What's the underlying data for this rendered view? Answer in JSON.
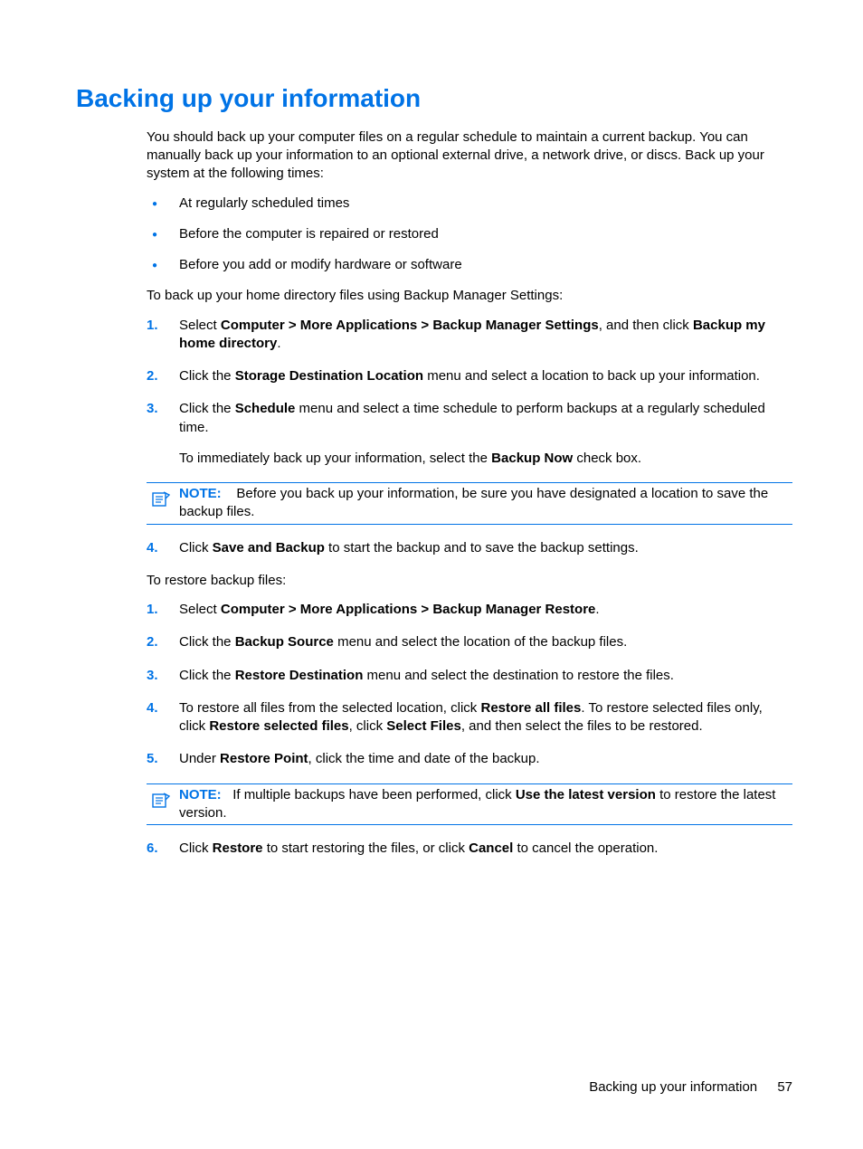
{
  "title": "Backing up your information",
  "intro": "You should back up your computer files on a regular schedule to maintain a current backup. You can manually back up your information to an optional external drive, a network drive, or discs. Back up your system at the following times:",
  "bullets": [
    "At regularly scheduled times",
    "Before the computer is repaired or restored",
    "Before you add or modify hardware or software"
  ],
  "backup_lead": "To back up your home directory files using Backup Manager Settings:",
  "backup_steps": {
    "s1_a": "Select ",
    "s1_b": "Computer > More Applications > Backup Manager Settings",
    "s1_c": ", and then click ",
    "s1_d": "Backup my home directory",
    "s1_e": ".",
    "s2_a": "Click the ",
    "s2_b": "Storage Destination Location",
    "s2_c": " menu and select a location to back up your information.",
    "s3_a": "Click the ",
    "s3_b": "Schedule",
    "s3_c": " menu and select a time schedule to perform backups at a regularly scheduled time.",
    "s3_sub_a": "To immediately back up your information, select the ",
    "s3_sub_b": "Backup Now",
    "s3_sub_c": " check box.",
    "s4_a": "Click ",
    "s4_b": "Save and Backup",
    "s4_c": " to start the backup and to save the backup settings."
  },
  "note1": {
    "label": "NOTE:",
    "text": "Before you back up your information, be sure you have designated a location to save the backup files."
  },
  "restore_lead": "To restore backup files:",
  "restore_steps": {
    "s1_a": "Select ",
    "s1_b": "Computer > More Applications > Backup Manager Restore",
    "s1_c": ".",
    "s2_a": "Click the ",
    "s2_b": "Backup Source",
    "s2_c": " menu and select the location of the backup files.",
    "s3_a": "Click the ",
    "s3_b": "Restore Destination",
    "s3_c": " menu and select the destination to restore the files.",
    "s4_a": "To restore all files from the selected location, click ",
    "s4_b": "Restore all files",
    "s4_c": ". To restore selected files only, click ",
    "s4_d": "Restore selected files",
    "s4_e": ", click ",
    "s4_f": "Select Files",
    "s4_g": ", and then select the files to be restored.",
    "s5_a": "Under ",
    "s5_b": "Restore Point",
    "s5_c": ", click the time and date of the backup.",
    "s6_a": "Click ",
    "s6_b": "Restore",
    "s6_c": " to start restoring the files, or click ",
    "s6_d": "Cancel",
    "s6_e": " to cancel the operation."
  },
  "note2": {
    "label": "NOTE:",
    "text_a": "If multiple backups have been performed, click ",
    "text_b": "Use the latest version",
    "text_c": " to restore the latest version."
  },
  "footer": {
    "title": "Backing up your information",
    "page": "57"
  }
}
